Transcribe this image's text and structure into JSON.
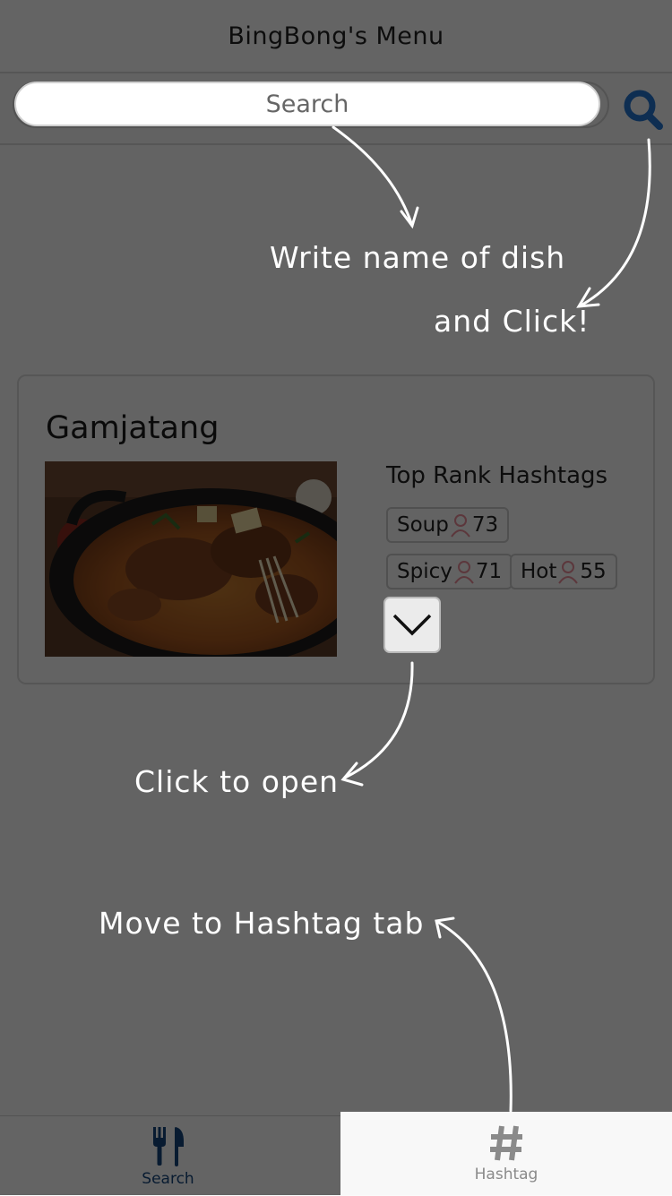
{
  "header": {
    "title": "BingBong's Menu"
  },
  "search": {
    "placeholder": "Search",
    "icon": "search-icon"
  },
  "dish": {
    "name": "Gamjatang",
    "hashtags_heading": "Top Rank Hashtags",
    "hashtags": [
      {
        "tag": "Soup",
        "count": "73"
      },
      {
        "tag": "Spicy",
        "count": "71"
      },
      {
        "tag": "Hot",
        "count": "55"
      }
    ],
    "expand_icon": "chevron-down-icon"
  },
  "tabs": [
    {
      "label": "Search",
      "icon": "fork-knife-icon"
    },
    {
      "label": "Hashtag",
      "icon": "hash-icon"
    }
  ],
  "tips": {
    "search_line1": "Write name of dish",
    "search_line2": "and Click!",
    "expand": "Click to open",
    "hashtag_tab": "Move to Hashtag tab"
  },
  "colors": {
    "accent": "#14447a",
    "tab_inactive": "#8a8a8a",
    "person_icon": "#e58a96",
    "overlay": "#000000"
  }
}
